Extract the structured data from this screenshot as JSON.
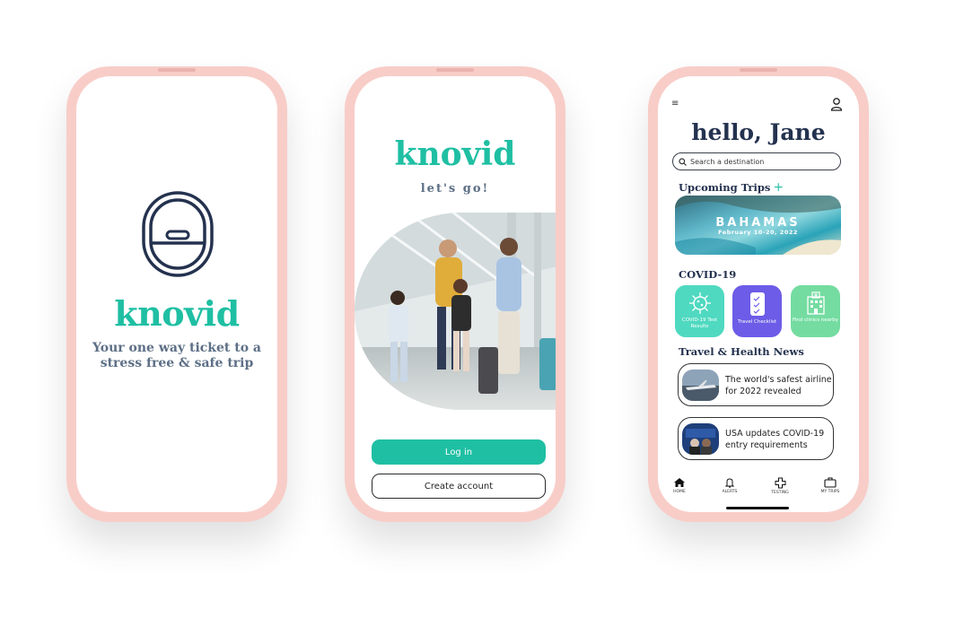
{
  "phone1": {
    "brand": "knovid",
    "tagline": "Your one way ticket to a stress free & safe trip",
    "logo_icon": "airplane-window-icon"
  },
  "phone2": {
    "brand": "knovid",
    "subtitle": "let's go!",
    "login_label": "Log in",
    "create_label": "Create account"
  },
  "phone3": {
    "greeting": "hello, Jane",
    "search_placeholder": "Search a destination",
    "upcoming_title": "Upcoming Trips",
    "add_symbol": "+",
    "trip": {
      "name": "BAHAMAS",
      "dates": "February 10-20, 2022"
    },
    "covid_title": "COVID-19",
    "tiles": [
      {
        "label": "COVID-19 Test Results",
        "icon": "virus-icon",
        "color": "#4fd9c0"
      },
      {
        "label": "Travel Checklist",
        "icon": "checklist-icon",
        "color": "#6c5ce7"
      },
      {
        "label": "Find clinics nearby",
        "icon": "clinic-icon",
        "color": "#74dca1"
      }
    ],
    "news_title": "Travel & Health News",
    "news": [
      {
        "headline": "The world's safest airline for 2022 revealed"
      },
      {
        "headline": "USA updates COVID-19 entry requirements"
      }
    ],
    "tabs": [
      {
        "label": "HOME",
        "icon": "home-icon"
      },
      {
        "label": "ALERTS",
        "icon": "bell-icon"
      },
      {
        "label": "TESTING",
        "icon": "medical-cross-icon"
      },
      {
        "label": "MY TRIPS",
        "icon": "suitcase-icon"
      }
    ]
  },
  "colors": {
    "brand": "#1fbfa3",
    "navy": "#24324f",
    "phone_frame": "#f8cdc8"
  }
}
